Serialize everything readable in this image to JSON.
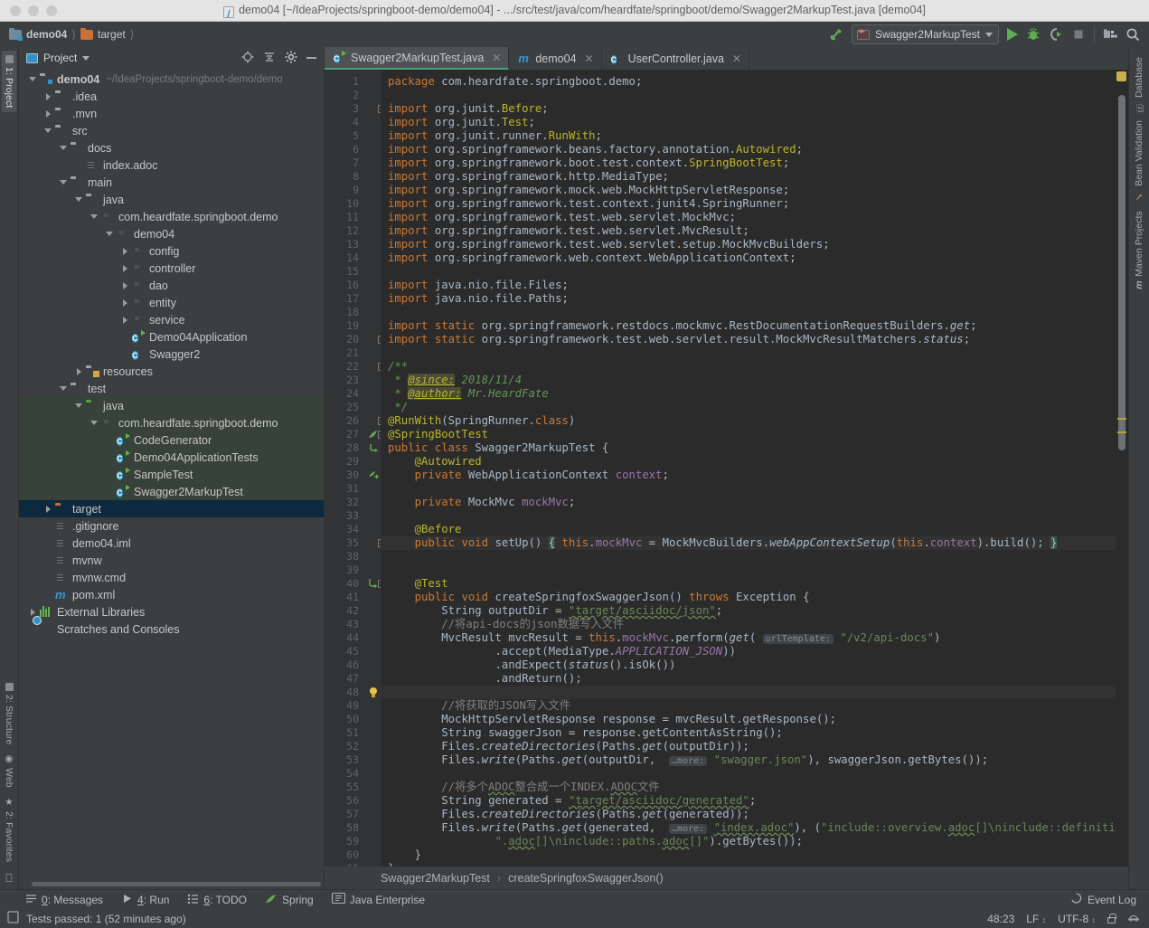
{
  "window": {
    "title": "demo04 [~/IdeaProjects/springboot-demo/demo04] - .../src/test/java/com/heardfate/springboot/demo/Swagger2MarkupTest.java [demo04]"
  },
  "navbar": {
    "crumbs": [
      {
        "label": "demo04",
        "icon": "module-folder-icon"
      },
      {
        "label": "target",
        "icon": "folder-orange-icon"
      }
    ],
    "run_config": "Swagger2MarkupTest",
    "actions": [
      "build-icon",
      "run-icon",
      "debug-icon",
      "run-coverage-icon",
      "stop-icon",
      "project-structure-icon",
      "search-icon"
    ]
  },
  "left_strip": {
    "top": [
      "1: Project"
    ],
    "bottom": [
      "2: Structure",
      "Web",
      "2: Favorites"
    ]
  },
  "right_strip": [
    "Database",
    "Bean Validation",
    "Maven Projects"
  ],
  "project_panel": {
    "title": "Project",
    "tools": [
      "locate-icon",
      "collapse-all-icon",
      "settings-gear-icon",
      "hide-icon"
    ],
    "tree": [
      {
        "depth": 0,
        "arrow": "down",
        "icon": "module-folder-icon",
        "label": "demo04",
        "bold": true,
        "path": "~/IdeaProjects/springboot-demo/demo",
        "state": ""
      },
      {
        "depth": 1,
        "arrow": "right",
        "icon": "folder-icon",
        "label": ".idea",
        "state": ""
      },
      {
        "depth": 1,
        "arrow": "right",
        "icon": "folder-icon",
        "label": ".mvn",
        "state": ""
      },
      {
        "depth": 1,
        "arrow": "down",
        "icon": "folder-icon",
        "label": "src",
        "state": ""
      },
      {
        "depth": 2,
        "arrow": "down",
        "icon": "folder-icon",
        "label": "docs",
        "state": ""
      },
      {
        "depth": 3,
        "arrow": "none",
        "icon": "file-icon",
        "label": "index.adoc",
        "state": ""
      },
      {
        "depth": 2,
        "arrow": "down",
        "icon": "folder-icon",
        "label": "main",
        "state": ""
      },
      {
        "depth": 3,
        "arrow": "down",
        "icon": "source-folder-icon",
        "label": "java",
        "state": ""
      },
      {
        "depth": 4,
        "arrow": "down",
        "icon": "package-icon",
        "label": "com.heardfate.springboot.demo",
        "state": ""
      },
      {
        "depth": 5,
        "arrow": "down",
        "icon": "package-icon",
        "label": "demo04",
        "state": ""
      },
      {
        "depth": 6,
        "arrow": "right",
        "icon": "package-icon",
        "label": "config",
        "state": ""
      },
      {
        "depth": 6,
        "arrow": "right",
        "icon": "package-icon",
        "label": "controller",
        "state": ""
      },
      {
        "depth": 6,
        "arrow": "right",
        "icon": "package-icon",
        "label": "dao",
        "state": ""
      },
      {
        "depth": 6,
        "arrow": "right",
        "icon": "package-icon",
        "label": "entity",
        "state": ""
      },
      {
        "depth": 6,
        "arrow": "right",
        "icon": "package-icon",
        "label": "service",
        "state": ""
      },
      {
        "depth": 6,
        "arrow": "none",
        "icon": "class-runnable-icon",
        "label": "Demo04Application",
        "state": ""
      },
      {
        "depth": 6,
        "arrow": "none",
        "icon": "class-icon",
        "label": "Swagger2",
        "state": ""
      },
      {
        "depth": 3,
        "arrow": "right",
        "icon": "resources-folder-icon",
        "label": "resources",
        "state": ""
      },
      {
        "depth": 2,
        "arrow": "down",
        "icon": "folder-icon",
        "label": "test",
        "state": ""
      },
      {
        "depth": 3,
        "arrow": "down",
        "icon": "test-source-folder-icon",
        "label": "java",
        "state": "green"
      },
      {
        "depth": 4,
        "arrow": "down",
        "icon": "package-icon",
        "label": "com.heardfate.springboot.demo",
        "state": "green"
      },
      {
        "depth": 5,
        "arrow": "none",
        "icon": "test-class-icon",
        "label": "CodeGenerator",
        "state": "green"
      },
      {
        "depth": 5,
        "arrow": "none",
        "icon": "test-class-icon",
        "label": "Demo04ApplicationTests",
        "state": "green"
      },
      {
        "depth": 5,
        "arrow": "none",
        "icon": "test-class-icon",
        "label": "SampleTest",
        "state": "green"
      },
      {
        "depth": 5,
        "arrow": "none",
        "icon": "test-class-icon",
        "label": "Swagger2MarkupTest",
        "state": "green"
      },
      {
        "depth": 1,
        "arrow": "right",
        "icon": "folder-orange-icon",
        "label": "target",
        "state": "selected"
      },
      {
        "depth": 1,
        "arrow": "none",
        "icon": "file-icon",
        "label": ".gitignore",
        "state": ""
      },
      {
        "depth": 1,
        "arrow": "none",
        "icon": "iml-file-icon",
        "label": "demo04.iml",
        "state": ""
      },
      {
        "depth": 1,
        "arrow": "none",
        "icon": "file-icon",
        "label": "mvnw",
        "state": ""
      },
      {
        "depth": 1,
        "arrow": "none",
        "icon": "file-icon",
        "label": "mvnw.cmd",
        "state": ""
      },
      {
        "depth": 1,
        "arrow": "none",
        "icon": "maven-file-icon",
        "label": "pom.xml",
        "state": ""
      },
      {
        "depth": 0,
        "arrow": "right",
        "icon": "library-icon",
        "label": "External Libraries",
        "state": ""
      },
      {
        "depth": 0,
        "arrow": "none",
        "icon": "scratches-icon",
        "label": "Scratches and Consoles",
        "state": ""
      }
    ]
  },
  "editor": {
    "tabs": [
      {
        "label": "Swagger2MarkupTest.java",
        "icon": "test-class-icon",
        "active": true
      },
      {
        "label": "demo04",
        "icon": "maven-file-icon",
        "active": false
      },
      {
        "label": "UserController.java",
        "icon": "class-icon",
        "active": false
      }
    ],
    "first_line": 1,
    "last_line": 61,
    "breadcrumb": [
      "Swagger2MarkupTest",
      "createSpringfoxSwaggerJson()"
    ]
  },
  "bottom_tools": [
    {
      "num": "0",
      "label": ": Messages",
      "icon": "messages-icon"
    },
    {
      "num": "4",
      "label": ": Run",
      "icon": "run-icon"
    },
    {
      "num": "6",
      "label": ": TODO",
      "icon": "todo-icon"
    },
    {
      "num": "",
      "label": "Spring",
      "icon": "spring-leaf-icon"
    },
    {
      "num": "",
      "label": "Java Enterprise",
      "icon": "java-ee-icon"
    }
  ],
  "bottom_right": {
    "event_log": "Event Log"
  },
  "statusbar": {
    "message": "Tests passed: 1 (52 minutes ago)",
    "caret": "48:23",
    "line_sep": "LF",
    "encoding": "UTF-8"
  },
  "colors": {
    "accent_green": "#4a9e7c",
    "selection_blue": "#0d293e",
    "test_green": "#37423a",
    "keyword": "#cc7832",
    "string": "#6a8759",
    "comment": "#808080",
    "javadoc": "#629755",
    "annotation": "#bbb529",
    "field": "#9876aa",
    "editor_bg": "#2b2b2b",
    "panel_bg": "#3c3f41"
  }
}
